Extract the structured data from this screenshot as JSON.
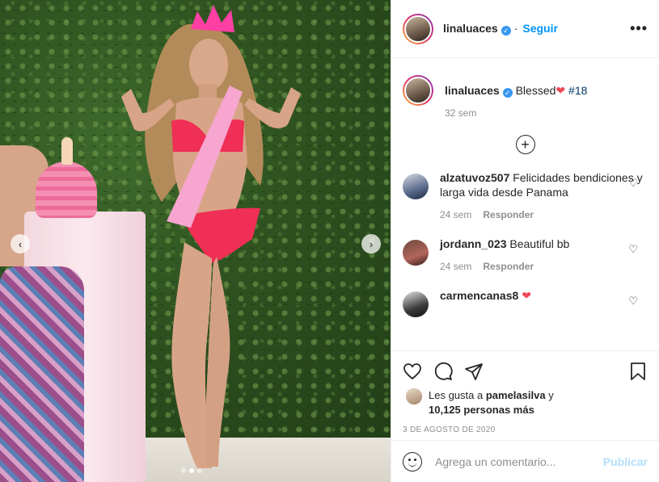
{
  "post": {
    "username": "linaluaces",
    "follow_label": "Seguir",
    "more_label": "•••",
    "verified_mark": "✓"
  },
  "caption": {
    "username": "linaluaces",
    "text": "Blessed",
    "hashtag": "#18",
    "age": "32 sem"
  },
  "comments": [
    {
      "username": "alzatuvoz507",
      "text": "Felicidades bendiciones y larga vida desde Panama",
      "age": "24 sem",
      "reply_label": "Responder"
    },
    {
      "username": "jordann_023",
      "text": "Beautiful bb",
      "age": "24 sem",
      "reply_label": "Responder"
    },
    {
      "username": "carmencanas8",
      "text": ""
    }
  ],
  "likes": {
    "prefix": "Les gusta a",
    "liker": "pamelasilva",
    "suffix": "y",
    "others": "10,125 personas más"
  },
  "date": "3 DE AGOSTO DE 2020",
  "comment_box": {
    "placeholder": "Agrega un comentario...",
    "publish_label": "Publicar"
  },
  "carousel": {
    "prev_icon": "‹",
    "next_icon": "›"
  },
  "icons": {
    "like": "heart-icon",
    "comment": "comment-icon",
    "share": "paper-plane-icon",
    "save": "bookmark-icon",
    "load_more": "plus-circle-icon",
    "emoji": "emoji-icon"
  },
  "colors": {
    "link": "#0095f6",
    "secondary_text": "#8e8e8e",
    "heart_red": "#ed4956",
    "publish_disabled": "#b2dffc"
  }
}
